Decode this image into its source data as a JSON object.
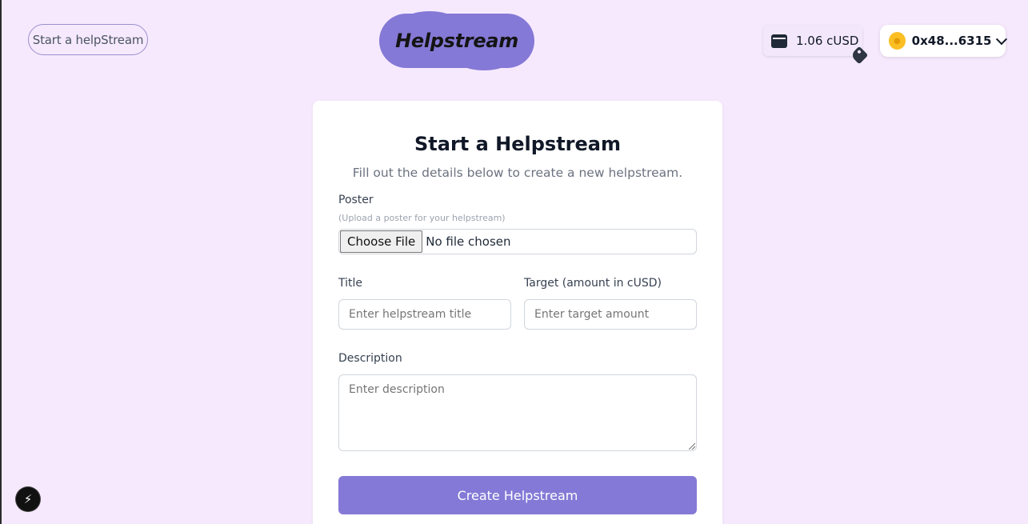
{
  "header": {
    "start_link": "Start a helpStream",
    "logo_text": "Helpstream",
    "balance": "1.06 cUSD",
    "wallet_icon": "wallet-icon",
    "tag_icon": "tag-icon",
    "account": "0x48...6315",
    "account_icon": "chevron-down-icon"
  },
  "form": {
    "title": "Start a Helpstream",
    "subtitle": "Fill out the details below to create a new helpstream.",
    "poster_label": "Poster",
    "poster_hint": "(Upload a poster for your helpstream)",
    "choose_file": "Choose File",
    "no_file": "No file chosen",
    "title_label": "Title",
    "title_placeholder": "Enter helpstream title",
    "target_label": "Target (amount in cUSD)",
    "target_placeholder": "Enter target amount",
    "description_label": "Description",
    "description_placeholder": "Enter description",
    "submit": "Create Helpstream"
  },
  "dev_tools": {
    "icon": "lightning-icon"
  },
  "colors": {
    "background": "#f6e9fd",
    "accent": "#8479d6"
  }
}
